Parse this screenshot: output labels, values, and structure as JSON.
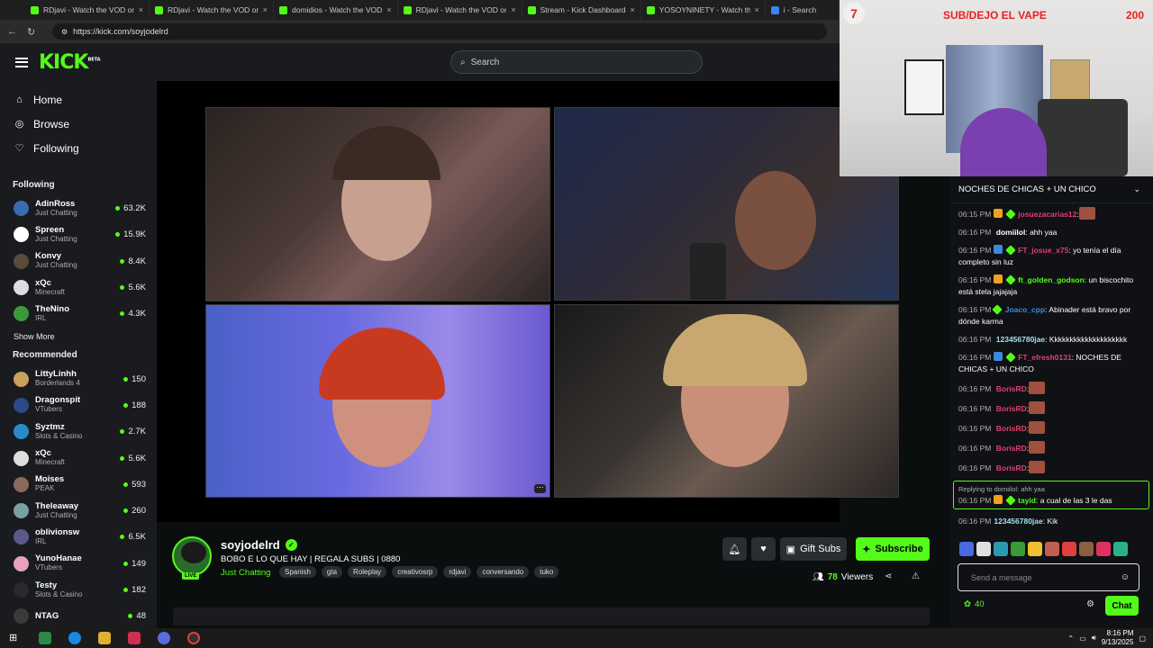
{
  "browser": {
    "tabs": [
      {
        "label": "RDjavi - Watch the VOD on",
        "fav": "kick"
      },
      {
        "label": "RDjavi - Watch the VOD on",
        "fav": "kick"
      },
      {
        "label": "domidios - Watch the VOD",
        "fav": "kick"
      },
      {
        "label": "RDjavi - Watch the VOD on",
        "fav": "kick"
      },
      {
        "label": "Stream - Kick Dashboard",
        "fav": "kick"
      },
      {
        "label": "YOSOYNINETY - Watch the",
        "fav": "kick"
      },
      {
        "label": "i - Search",
        "fav": "search"
      }
    ],
    "url": "https://kick.com/soyjodelrd"
  },
  "header": {
    "logo": "KICK",
    "beta": "BETA",
    "search_placeholder": "Search"
  },
  "sidebar": {
    "nav": [
      {
        "label": "Home",
        "icon": "home-icon"
      },
      {
        "label": "Browse",
        "icon": "compass-icon"
      },
      {
        "label": "Following",
        "icon": "heart-icon"
      }
    ],
    "following_title": "Following",
    "following": [
      {
        "name": "AdinRoss",
        "category": "Just Chatting",
        "viewers": "63.2K",
        "color": "#3a6ab0"
      },
      {
        "name": "Spreen",
        "category": "Just Chatting",
        "viewers": "15.9K",
        "color": "#ffffff"
      },
      {
        "name": "Konvy",
        "category": "Just Chatting",
        "viewers": "8.4K",
        "color": "#5a4a3a"
      },
      {
        "name": "xQc",
        "category": "Minecraft",
        "viewers": "5.6K",
        "color": "#dddddd"
      },
      {
        "name": "TheNino",
        "category": "IRL",
        "viewers": "4.3K",
        "color": "#3a9a3a"
      }
    ],
    "show_more": "Show More",
    "recommended_title": "Recommended",
    "recommended": [
      {
        "name": "LittyLinhh",
        "category": "Borderlands 4",
        "viewers": "150",
        "color": "#c8a060"
      },
      {
        "name": "Dragonspit",
        "category": "VTubers",
        "viewers": "188",
        "color": "#2a4a8a"
      },
      {
        "name": "Syztmz",
        "category": "Slots & Casino",
        "viewers": "2.7K",
        "color": "#2a8ac8"
      },
      {
        "name": "xQc",
        "category": "Minecraft",
        "viewers": "5.6K",
        "color": "#dddddd"
      },
      {
        "name": "Moises",
        "category": "PEAK",
        "viewers": "593",
        "color": "#8a6a5a"
      },
      {
        "name": "Theleaway",
        "category": "Just Chatting",
        "viewers": "260",
        "color": "#7aa0a0"
      },
      {
        "name": "oblivionsw",
        "category": "IRL",
        "viewers": "6.5K",
        "color": "#5a5a8a"
      },
      {
        "name": "YunoHanae",
        "category": "VTubers",
        "viewers": "149",
        "color": "#e8a0c0"
      },
      {
        "name": "Testy",
        "category": "Slots & Casino",
        "viewers": "182",
        "color": "#2a2a2a"
      },
      {
        "name": "NTAG",
        "category": "",
        "viewers": "48",
        "color": "#3a3a3a"
      }
    ]
  },
  "stream": {
    "username": "soyjodelrd",
    "title": "BOBO E LO QUE HAY | REGALA SUBS | 0880",
    "category": "Just Chatting",
    "live": "LIVE",
    "tags": [
      "Spanish",
      "gta",
      "Roleplay",
      "creativosrp",
      "rdjavi",
      "conversando",
      "tuko"
    ],
    "gift_label": "Gift Subs",
    "subscribe_label": "Subscribe",
    "viewers_count": "78",
    "viewers_label": "Viewers"
  },
  "chat": {
    "pinned": "NOCHES DE CHICAS + UN CHICO",
    "messages": [
      {
        "time": "06:15 PM",
        "user": "josuezacarias12",
        "color": "#e04070",
        "badges": [
          "y",
          "g"
        ],
        "text": ":",
        "emote": true
      },
      {
        "time": "06:16 PM",
        "user": "domiilol",
        "color": "#ffffff",
        "badges": [],
        "text": ": ahh yaa"
      },
      {
        "time": "06:16 PM",
        "user": "FT_josue_x75",
        "color": "#e04070",
        "badges": [
          "b",
          "g"
        ],
        "text": ": yo tenía el día completo sin luz"
      },
      {
        "time": "06:16 PM",
        "user": "ft_golden_godson",
        "color": "#53fc18",
        "badges": [
          "y",
          "g"
        ],
        "text": ": un biscochito está stela jajajaja"
      },
      {
        "time": "06:16 PM",
        "user": "Joaco_cpp",
        "color": "#3b8ae0",
        "badges": [
          "g"
        ],
        "text": ": Abinader está bravo por dónde karma"
      },
      {
        "time": "06:16 PM",
        "user": "123456780jae",
        "color": "#a0e0f0",
        "badges": [],
        "text": ": Kkkkkkkkkkkkkkkkkkkk"
      },
      {
        "time": "06:16 PM",
        "user": "FT_efresh0131",
        "color": "#e04070",
        "badges": [
          "b",
          "g"
        ],
        "text": ": NOCHES DE CHICAS + UN CHICO"
      },
      {
        "time": "06:16 PM",
        "user": "BorisRD",
        "color": "#e04070",
        "badges": [],
        "text": ":",
        "emote": true
      },
      {
        "time": "06:16 PM",
        "user": "BorisRD",
        "color": "#e04070",
        "badges": [],
        "text": ":",
        "emote": true
      },
      {
        "time": "06:16 PM",
        "user": "BorisRD",
        "color": "#e04070",
        "badges": [],
        "text": ":",
        "emote": true
      },
      {
        "time": "06:16 PM",
        "user": "BorisRD",
        "color": "#e04070",
        "badges": [],
        "text": ":",
        "emote": true
      },
      {
        "time": "06:16 PM",
        "user": "BorisRD",
        "color": "#e04070",
        "badges": [],
        "text": ":",
        "emote": true
      }
    ],
    "reply": {
      "replying": "Replying to domiilol: ahh yaa",
      "time": "06:16 PM",
      "user": "tayid",
      "color": "#53fc18",
      "text": ": a cual de las 3 le das"
    },
    "last": {
      "time": "06:16 PM",
      "user": "123456780jae",
      "color": "#a0e0f0",
      "text": ": Kik"
    },
    "input_placeholder": "Send a message",
    "points": "40",
    "send_label": "Chat"
  },
  "overlay": {
    "counter_left": "7",
    "title": "SUB/DEJO EL VAPE",
    "counter_right": "200"
  },
  "taskbar": {
    "time": "8:16 PM",
    "date": "9/13/2025"
  }
}
